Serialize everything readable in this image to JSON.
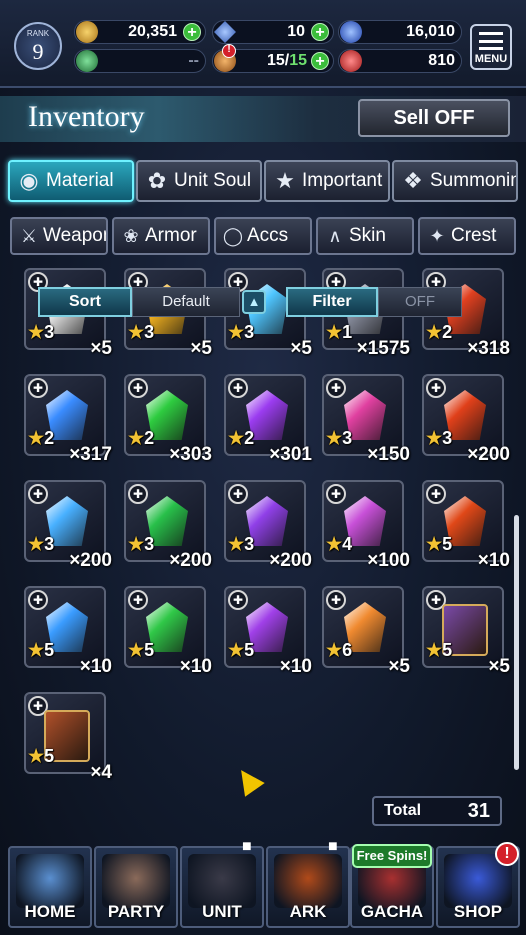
{
  "header": {
    "rank_label": "RANK",
    "rank_value": "9",
    "resources": [
      {
        "name": "gil",
        "value": "20,351",
        "icon": "gil-coin-icon",
        "color": "#d9a93a"
      },
      {
        "name": "lapis",
        "value": "10",
        "icon": "blue-crystal-icon",
        "color": "#5b8fe0"
      },
      {
        "name": "blue-orb",
        "value": "16,010",
        "icon": "blue-orb-icon",
        "color": "#3a6bd8"
      },
      {
        "name": "stamina",
        "value": "--",
        "icon": "sword-icon",
        "color": "#3da35a"
      },
      {
        "name": "energy",
        "value": "15/",
        "value_max": "15",
        "icon": "cookie-icon",
        "color": "#e08a3a"
      },
      {
        "name": "red-orb",
        "value": "810",
        "icon": "red-orb-icon",
        "color": "#d8322e"
      }
    ],
    "menu_label": "MENU"
  },
  "inventory": {
    "title": "Inventory",
    "sell_label": "Sell OFF"
  },
  "tabs": [
    {
      "label": "Material",
      "icon": "bag-icon",
      "active": true
    },
    {
      "label": "Unit Soul",
      "icon": "soul-icon",
      "active": false
    },
    {
      "label": "Important",
      "icon": "star-icon",
      "active": false
    },
    {
      "label": "Summoning",
      "icon": "summon-icon",
      "active": false
    }
  ],
  "subtabs": [
    {
      "label": "Weapon",
      "icon": "sword-icon"
    },
    {
      "label": "Armor",
      "icon": "armor-icon"
    },
    {
      "label": "Accs",
      "icon": "ring-icon"
    },
    {
      "label": "Skin",
      "icon": "hanger-icon"
    },
    {
      "label": "Crest",
      "icon": "crest-icon"
    }
  ],
  "sortbar": {
    "sort_label": "Sort",
    "sort_value": "Default",
    "filter_label": "Filter",
    "filter_value": "OFF"
  },
  "items": [
    {
      "rarity": "3",
      "qty": "×5",
      "color": "#e8e8e8"
    },
    {
      "rarity": "3",
      "qty": "×5",
      "color": "#f0b020"
    },
    {
      "rarity": "3",
      "qty": "×5",
      "color": "#4fc6ff"
    },
    {
      "rarity": "1",
      "qty": "×1575",
      "color": "#8a8fa0"
    },
    {
      "rarity": "2",
      "qty": "×318",
      "color": "#e04020"
    },
    {
      "rarity": "2",
      "qty": "×317",
      "color": "#3a8cff"
    },
    {
      "rarity": "2",
      "qty": "×303",
      "color": "#2ecc40"
    },
    {
      "rarity": "2",
      "qty": "×301",
      "color": "#9b3cf0"
    },
    {
      "rarity": "3",
      "qty": "×150",
      "color": "#e040a0"
    },
    {
      "rarity": "3",
      "qty": "×200",
      "color": "#e0401a"
    },
    {
      "rarity": "3",
      "qty": "×200",
      "color": "#48b0ff"
    },
    {
      "rarity": "3",
      "qty": "×200",
      "color": "#28c04a"
    },
    {
      "rarity": "3",
      "qty": "×200",
      "color": "#9040e8"
    },
    {
      "rarity": "4",
      "qty": "×100",
      "color": "#c850d8"
    },
    {
      "rarity": "5",
      "qty": "×10",
      "color": "#e04818"
    },
    {
      "rarity": "5",
      "qty": "×10",
      "color": "#3a9cff"
    },
    {
      "rarity": "5",
      "qty": "×10",
      "color": "#30c848"
    },
    {
      "rarity": "5",
      "qty": "×10",
      "color": "#a040e8"
    },
    {
      "rarity": "6",
      "qty": "×5",
      "color": "#f08a30"
    },
    {
      "rarity": "5",
      "qty": "×5",
      "color": "#7a4aa8",
      "book": true
    },
    {
      "rarity": "5",
      "qty": "×4",
      "color": "#b0502a",
      "book": true
    }
  ],
  "total": {
    "label": "Total",
    "value": "31"
  },
  "nav": [
    {
      "label": "HOME",
      "color": "#5a8fd0",
      "locked": false
    },
    {
      "label": "PARTY",
      "color": "#8a6a5a",
      "locked": false
    },
    {
      "label": "UNIT",
      "color": "#3a3a48",
      "locked": true
    },
    {
      "label": "ARK",
      "color": "#b04a1a",
      "locked": true
    },
    {
      "label": "GACHA",
      "color": "#a83030",
      "locked": false
    },
    {
      "label": "SHOP",
      "color": "#3a5ad8",
      "locked": false
    }
  ],
  "free_spins_label": "Free Spins!",
  "shop_badge": "!",
  "energy_badge": "!"
}
